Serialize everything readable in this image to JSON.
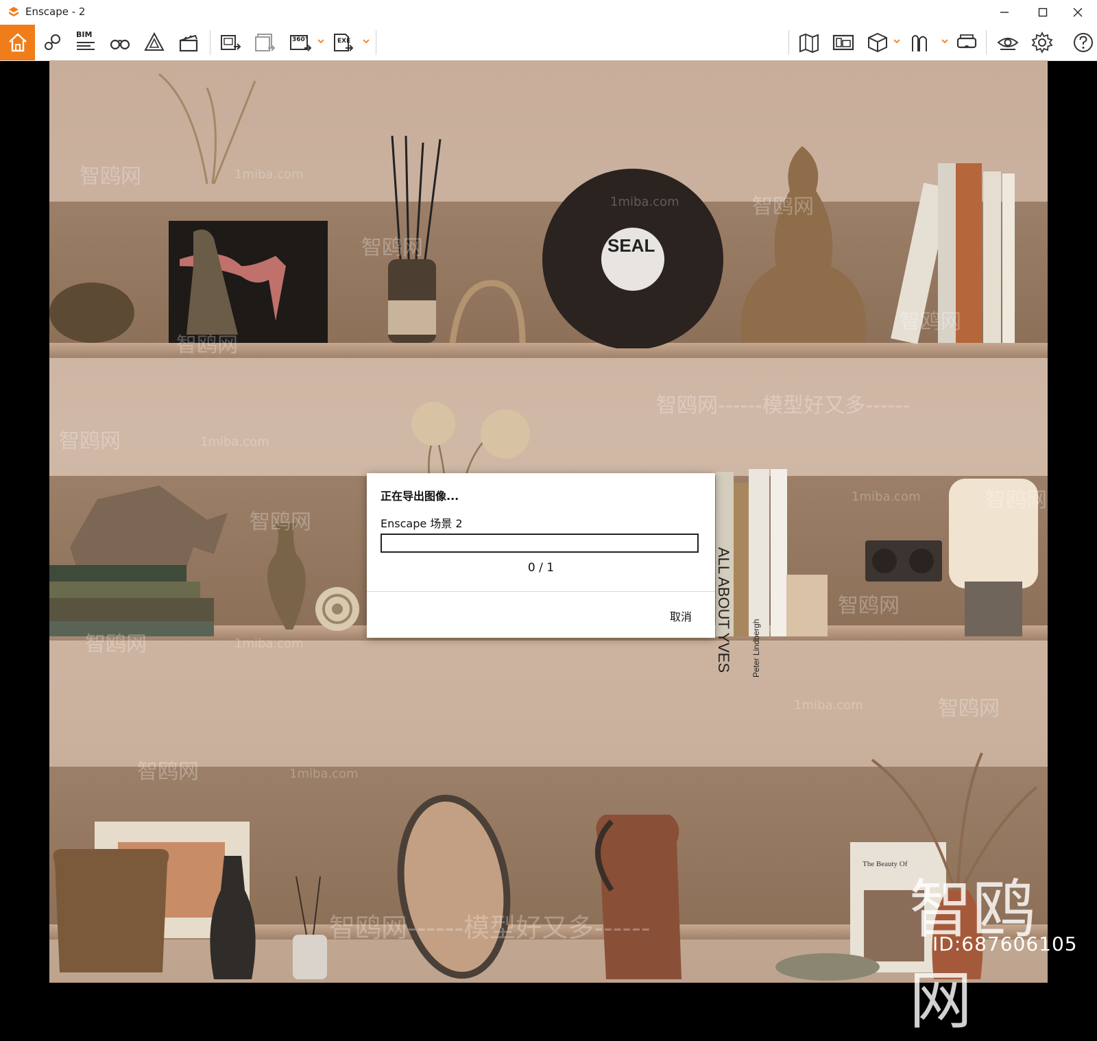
{
  "window": {
    "title": "Enscape - 2",
    "accent_color": "#f07d1a",
    "controls": [
      "minimize-icon",
      "maximize-icon",
      "close-icon"
    ]
  },
  "toolbar": {
    "left_tools": [
      "home-icon",
      "location-pin-icon",
      "bim-icon",
      "binoculars-icon",
      "perspective-icon",
      "clapperboard-icon",
      "screenshot-export-icon",
      "batch-export-icon",
      "panorama-360-icon",
      "exe-export-icon"
    ],
    "bim_label": "BIM",
    "panorama_label": "360°",
    "exe_label": "EXE",
    "right_tools": [
      "map-icon",
      "asset-library-icon",
      "box-icon",
      "people-icon",
      "vr-headset-icon",
      "eye-icon",
      "gear-icon",
      "help-icon"
    ]
  },
  "dialog": {
    "title": "正在导出图像...",
    "scene_name": "Enscape 场景 2",
    "progress_text": "0 / 1",
    "progress_fraction": 0,
    "cancel_label": "取消"
  },
  "watermarks": {
    "brand": "智鸥网",
    "site": "1miba.com",
    "slogan": "智鸥网------模型好又多------",
    "big_brand": "智鸥网",
    "id": "ID:687606105"
  },
  "scene_text": {
    "record_label": "SEAL",
    "book_spine_1": "ALL ABOUT YVES",
    "book_spine_2": "Peter Lindbergh",
    "book_cover": "The Beauty Of"
  }
}
